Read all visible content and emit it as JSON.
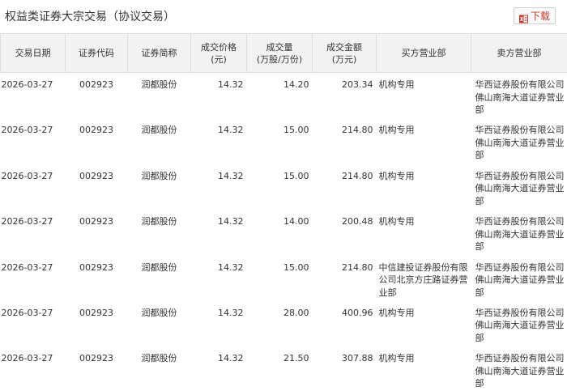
{
  "header": {
    "title": "权益类证券大宗交易（协议交易）",
    "download_label": "下载"
  },
  "icons": {
    "download": "excel-download-icon"
  },
  "colors": {
    "download_accent": "#c0392b",
    "header_bg": "#f2f2f2"
  },
  "table": {
    "columns": [
      {
        "line1": "交易日期",
        "line2": ""
      },
      {
        "line1": "证券代码",
        "line2": ""
      },
      {
        "line1": "证券简称",
        "line2": ""
      },
      {
        "line1": "成交价格",
        "line2": "(元)"
      },
      {
        "line1": "成交量",
        "line2": "(万股/万份)"
      },
      {
        "line1": "成交金额",
        "line2": "(万元)"
      },
      {
        "line1": "买方营业部",
        "line2": ""
      },
      {
        "line1": "卖方营业部",
        "line2": ""
      }
    ],
    "rows": [
      {
        "date": "2026-03-27",
        "code": "002923",
        "name": "润都股份",
        "price": "14.32",
        "volume": "14.20",
        "amount": "203.34",
        "buyer": "机构专用",
        "seller": "华西证券股份有限公司佛山南海大道证券营业部"
      },
      {
        "date": "2026-03-27",
        "code": "002923",
        "name": "润都股份",
        "price": "14.32",
        "volume": "15.00",
        "amount": "214.80",
        "buyer": "机构专用",
        "seller": "华西证券股份有限公司佛山南海大道证券营业部"
      },
      {
        "date": "2026-03-27",
        "code": "002923",
        "name": "润都股份",
        "price": "14.32",
        "volume": "15.00",
        "amount": "214.80",
        "buyer": "机构专用",
        "seller": "华西证券股份有限公司佛山南海大道证券营业部"
      },
      {
        "date": "2026-03-27",
        "code": "002923",
        "name": "润都股份",
        "price": "14.32",
        "volume": "14.00",
        "amount": "200.48",
        "buyer": "机构专用",
        "seller": "华西证券股份有限公司佛山南海大道证券营业部"
      },
      {
        "date": "2026-03-27",
        "code": "002923",
        "name": "润都股份",
        "price": "14.32",
        "volume": "15.00",
        "amount": "214.80",
        "buyer": "中信建投证券股份有限公司北京方庄路证券营业部",
        "seller": "华西证券股份有限公司佛山南海大道证券营业部"
      },
      {
        "date": "2026-03-27",
        "code": "002923",
        "name": "润都股份",
        "price": "14.32",
        "volume": "28.00",
        "amount": "400.96",
        "buyer": "机构专用",
        "seller": "华西证券股份有限公司佛山南海大道证券营业部"
      },
      {
        "date": "2026-03-27",
        "code": "002923",
        "name": "润都股份",
        "price": "14.32",
        "volume": "21.50",
        "amount": "307.88",
        "buyer": "机构专用",
        "seller": "华西证券股份有限公司佛山南海大道证券营业部"
      }
    ]
  }
}
